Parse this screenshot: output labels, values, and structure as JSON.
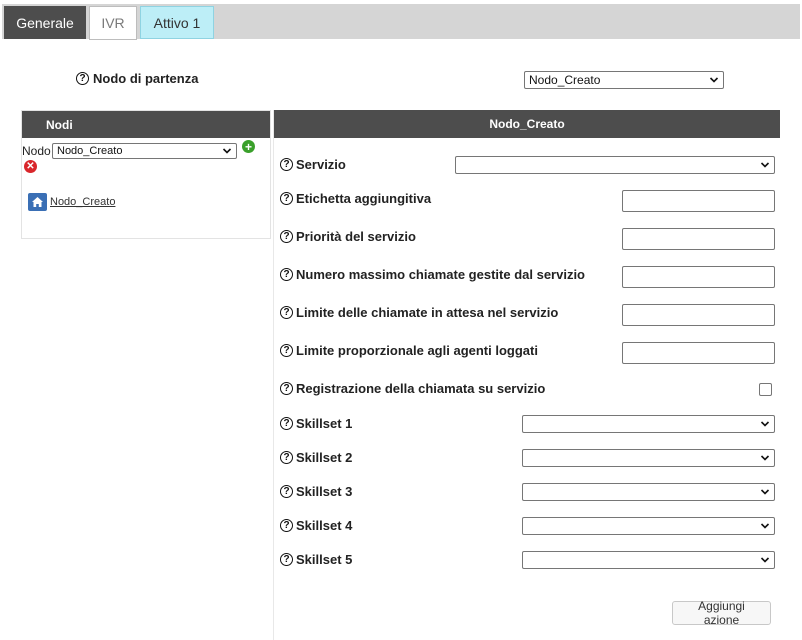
{
  "tabs": [
    {
      "label": "Generale"
    },
    {
      "label": "IVR"
    },
    {
      "label": "Attivo 1"
    }
  ],
  "start_node": {
    "label": "Nodo di partenza",
    "selected": "Nodo_Creato"
  },
  "nodes_panel": {
    "title": "Nodi",
    "nodo_label": "Nodo",
    "nodo_selected": "Nodo_Creato",
    "tree_item": "Nodo_Creato"
  },
  "node_panel": {
    "title": "Nodo_Creato",
    "fields": {
      "servizio": "Servizio",
      "etichetta": "Etichetta aggiungitiva",
      "priorita": "Priorità del servizio",
      "numero_max": "Numero massimo chiamate gestite dal servizio",
      "limite_attesa": "Limite delle chiamate in attesa nel servizio",
      "limite_proporzionale": "Limite proporzionale agli agenti loggati",
      "registrazione": "Registrazione della chiamata su servizio",
      "skillset1": "Skillset 1",
      "skillset2": "Skillset 2",
      "skillset3": "Skillset 3",
      "skillset4": "Skillset 4",
      "skillset5": "Skillset 5"
    },
    "add_action": "Aggiungi azione"
  },
  "help_glyph": "?",
  "icons": {
    "help": "question-circle-icon",
    "add": "plus-circle-icon",
    "delete": "x-circle-icon",
    "home": "home-icon",
    "dropdown": "chevron-down-icon"
  },
  "colors": {
    "header_dark": "#4d4d4d",
    "active_tab": "#bdeef7",
    "add_green": "#3aa02b",
    "delete_red": "#d9262b",
    "home_blue": "#3a6fb5"
  }
}
